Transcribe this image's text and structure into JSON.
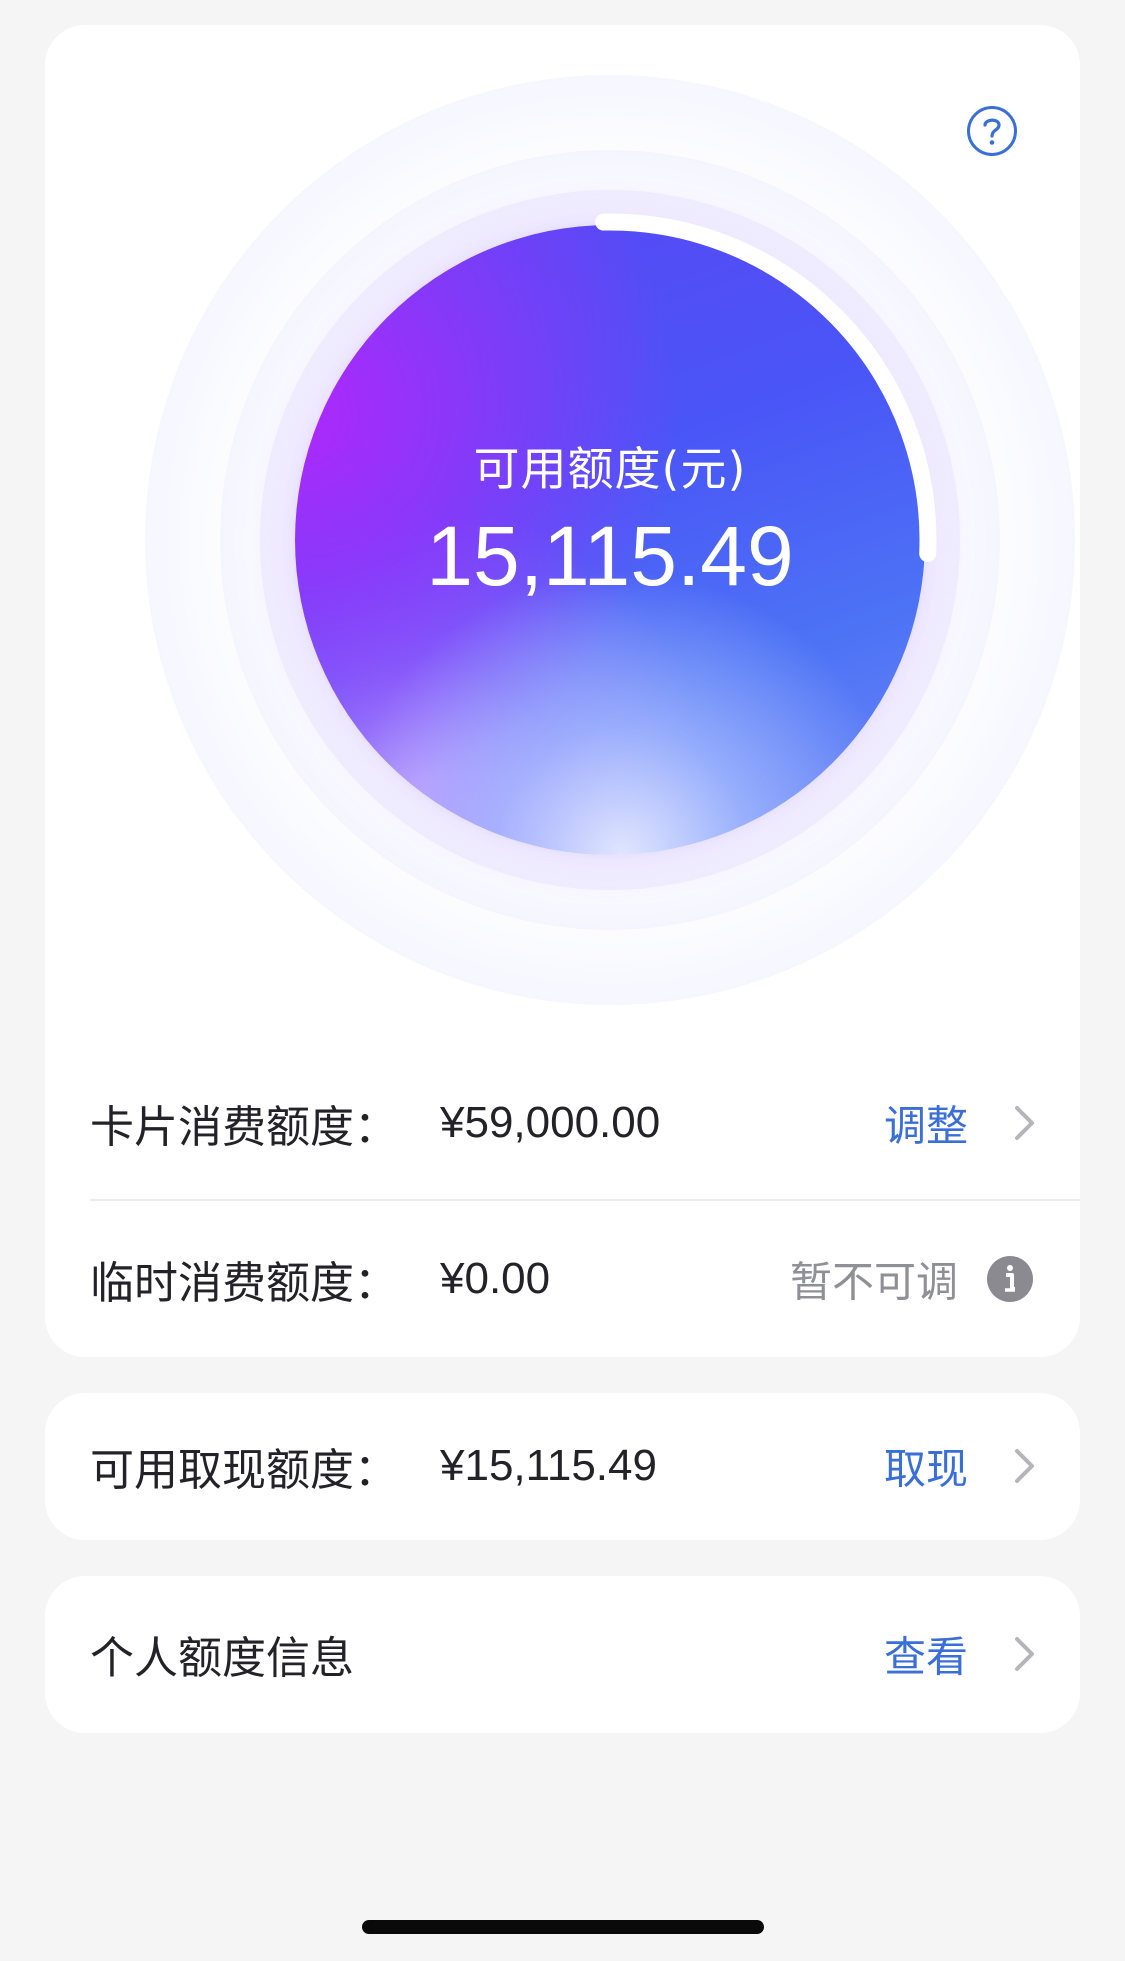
{
  "gauge": {
    "title": "可用额度(元)",
    "amount": "15,115.49",
    "progress_fraction": 0.26
  },
  "limits": {
    "card_spending": {
      "label": "卡片消费额度：",
      "value": "¥59,000.00",
      "action": "调整"
    },
    "temporary_spending": {
      "label": "临时消费额度：",
      "value": "¥0.00",
      "action": "暂不可调"
    }
  },
  "cash": {
    "label": "可用取现额度：",
    "value": "¥15,115.49",
    "action": "取现"
  },
  "personal": {
    "label": "个人额度信息",
    "action": "查看"
  },
  "icons": {
    "help": "question-circle-icon",
    "info": "info-circle-icon",
    "chevron": "chevron-right-icon"
  },
  "colors": {
    "accent_blue": "#3a6fd8",
    "muted_gray": "#8f8f96",
    "background": "#f5f5f6",
    "card": "#ffffff"
  }
}
